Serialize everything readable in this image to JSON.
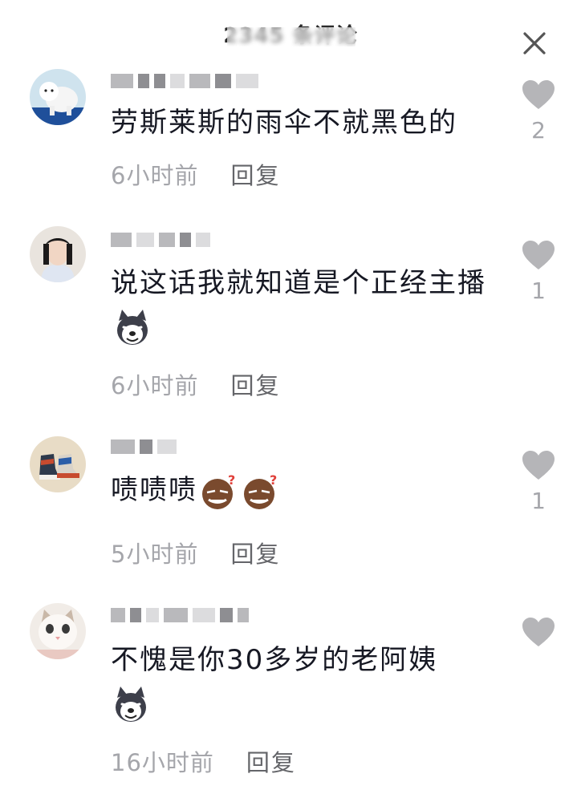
{
  "header": {
    "title": "2345 条评论",
    "close_icon": "close-icon"
  },
  "comments": [
    {
      "text": "劳斯莱斯的雨伞不就黑色的",
      "time": "6小时前",
      "reply_label": "回复",
      "likes": "2",
      "avatar": "white-puppy-avatar",
      "emojis": []
    },
    {
      "text": "说这话我就知道是个正经主播",
      "time": "6小时前",
      "reply_label": "回复",
      "likes": "1",
      "avatar": "man-portrait-avatar",
      "emojis": [
        "husky-dog-emoji"
      ]
    },
    {
      "text": "啧啧啧",
      "time": "5小时前",
      "reply_label": "回复",
      "likes": "1",
      "avatar": "sneakers-avatar",
      "emojis": [
        "puzzled-face-emoji",
        "puzzled-face-emoji"
      ]
    },
    {
      "text": "不愧是你30多岁的老阿姨",
      "time": "16小时前",
      "reply_label": "回复",
      "likes": "",
      "avatar": "cat-avatar",
      "emojis": [
        "husky-dog-emoji"
      ]
    }
  ],
  "colors": {
    "text": "#161823",
    "secondary": "#a5a6ab",
    "reply": "#646569",
    "heart": "#b5b5b8"
  }
}
